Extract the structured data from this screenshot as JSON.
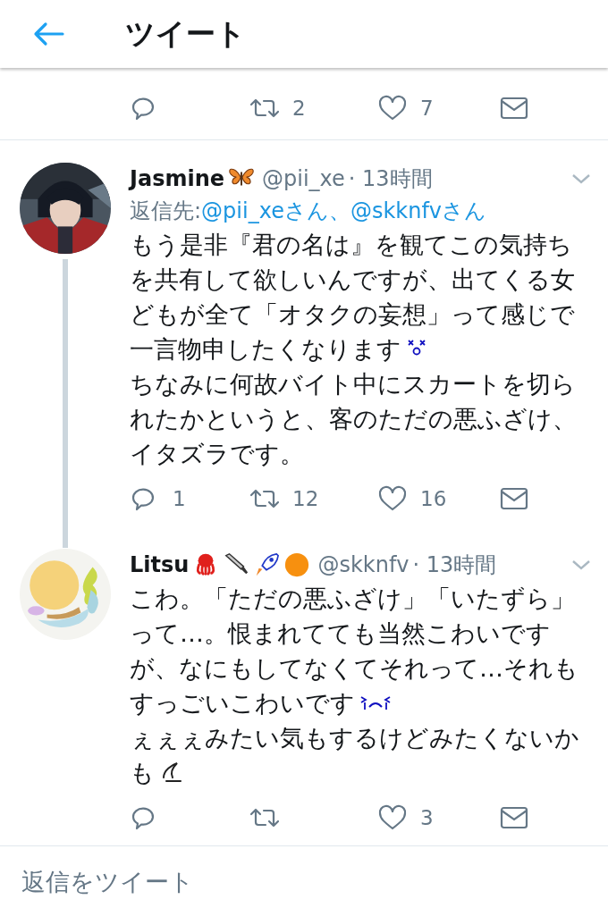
{
  "header": {
    "title": "ツイート"
  },
  "previous_actions": {
    "retweet": "2",
    "like": "7"
  },
  "tweets": [
    {
      "name": "Jasmine",
      "handle": "@pii_xe",
      "time": "· 13時間",
      "thread_below": true,
      "reply_to": {
        "label": "返信先: ",
        "users": "@pii_xeさん、@skknfvさん"
      },
      "lines": [
        "もう是非『君の名は』を観てこの気持ち",
        "を共有して欲しいんですが、出てくる女",
        "どもが全て「オタクの妄想」って感じで",
        "一言物申したくなります",
        "ちなみに何故バイト中にスカートを切ら",
        "れたかというと、客のただの悪ふざけ、",
        "イタズラです。"
      ],
      "actions": {
        "reply": "1",
        "retweet": "12",
        "like": "16"
      }
    },
    {
      "name": "Litsu",
      "handle": "@skknfv",
      "time": "· 13時間",
      "thread_below": false,
      "lines": [
        "こわ。「ただの悪ふざけ」「いたずら」",
        "って…。恨まれてても当然こわいです",
        "が、なにもしてなくてそれって…それも",
        "すっごいこわいです",
        "ぇぇぇみたい気もするけどみたくないか",
        "も"
      ],
      "actions": {
        "like": "3"
      }
    }
  ],
  "reply_bar": {
    "placeholder": "返信をツイート"
  }
}
